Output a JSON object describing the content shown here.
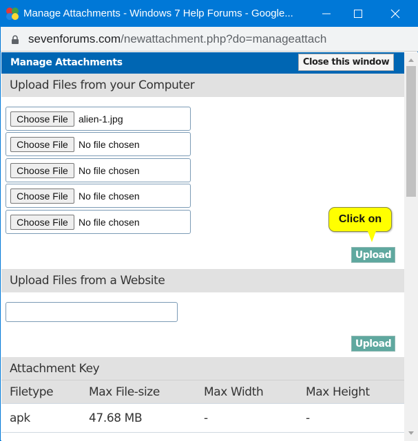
{
  "window": {
    "title": "Manage Attachments - Windows 7 Help Forums - Google...",
    "controls": {
      "minimize": "minimize",
      "maximize": "maximize",
      "close": "close"
    }
  },
  "address_bar": {
    "host": "sevenforums.com",
    "path": "/newattachment.php?do=manageattach"
  },
  "page": {
    "header_title": "Manage Attachments",
    "close_window_label": "Close this window",
    "upload_computer": {
      "heading": "Upload Files from your Computer",
      "files": [
        {
          "button": "Choose File",
          "value": "alien-1.jpg"
        },
        {
          "button": "Choose File",
          "value": "No file chosen"
        },
        {
          "button": "Choose File",
          "value": "No file chosen"
        },
        {
          "button": "Choose File",
          "value": "No file chosen"
        },
        {
          "button": "Choose File",
          "value": "No file chosen"
        }
      ],
      "upload_label": "Upload",
      "callout": "Click on"
    },
    "upload_website": {
      "heading": "Upload Files from a Website",
      "url_value": "",
      "upload_label": "Upload"
    },
    "attachment_key": {
      "heading": "Attachment Key",
      "columns": [
        "Filetype",
        "Max File-size",
        "Max Width",
        "Max Height"
      ],
      "rows": [
        [
          "apk",
          "47.68 MB",
          "-",
          "-"
        ]
      ]
    }
  },
  "colors": {
    "titlebar": "#0078d7",
    "header_bar": "#0066b3",
    "upload_button": "#5fa89f",
    "callout": "#ffff00",
    "section_head": "#e1e1e1"
  }
}
